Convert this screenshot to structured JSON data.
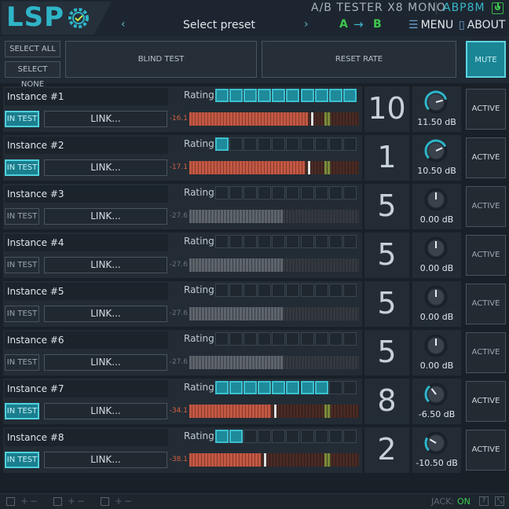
{
  "header": {
    "logo": "LSP",
    "title": "A/B TESTER X8 MONO",
    "plugin_id": "ABP8M",
    "preset_prev": "‹",
    "preset_label": "Select preset",
    "preset_next": "›",
    "ab_a": "A",
    "ab_arrow": "→",
    "ab_b": "B",
    "menu_label": "MENU",
    "about_label": "ABOUT"
  },
  "controls": {
    "select_all": "SELECT ALL",
    "select_none": "SELECT NONE",
    "blind_test": "BLIND TEST",
    "reset_rate": "RESET RATE",
    "mute": "MUTE"
  },
  "rating_label": "Rating",
  "link_label": "LINK...",
  "in_test_label": "IN TEST",
  "active_label": "ACTIVE",
  "instances": [
    {
      "name": "Instance #1",
      "rating": 10,
      "in_test": true,
      "level_db": "-16.1",
      "meter_fill": 0.7,
      "score": "10",
      "gain": "11.50 dB",
      "knob_value": 0.78
    },
    {
      "name": "Instance #2",
      "rating": 1,
      "in_test": true,
      "level_db": "-17.1",
      "meter_fill": 0.68,
      "score": "1",
      "gain": "10.50 dB",
      "knob_value": 0.74
    },
    {
      "name": "Instance #3",
      "rating": 0,
      "in_test": false,
      "level_db": "-27.6",
      "meter_fill": 0.55,
      "score": "5",
      "gain": "0.00 dB",
      "knob_value": 0.5
    },
    {
      "name": "Instance #4",
      "rating": 0,
      "in_test": false,
      "level_db": "-27.6",
      "meter_fill": 0.55,
      "score": "5",
      "gain": "0.00 dB",
      "knob_value": 0.5
    },
    {
      "name": "Instance #5",
      "rating": 0,
      "in_test": false,
      "level_db": "-27.6",
      "meter_fill": 0.55,
      "score": "5",
      "gain": "0.00 dB",
      "knob_value": 0.5
    },
    {
      "name": "Instance #6",
      "rating": 0,
      "in_test": false,
      "level_db": "-27.6",
      "meter_fill": 0.55,
      "score": "5",
      "gain": "0.00 dB",
      "knob_value": 0.5
    },
    {
      "name": "Instance #7",
      "rating": 8,
      "in_test": true,
      "level_db": "-34.1",
      "meter_fill": 0.48,
      "score": "8",
      "gain": "-6.50 dB",
      "knob_value": 0.36
    },
    {
      "name": "Instance #8",
      "rating": 2,
      "in_test": true,
      "level_db": "-38.1",
      "meter_fill": 0.42,
      "score": "2",
      "gain": "-10.50 dB",
      "knob_value": 0.28
    }
  ],
  "footer": {
    "plus": "+",
    "minus": "−",
    "jack_label": "JACK:",
    "jack_status": "ON",
    "help": "?",
    "resize": "⤡"
  },
  "colors": {
    "accent": "#2fb5c8",
    "active_green": "#3ec94e",
    "meter_red": "#c25843"
  }
}
